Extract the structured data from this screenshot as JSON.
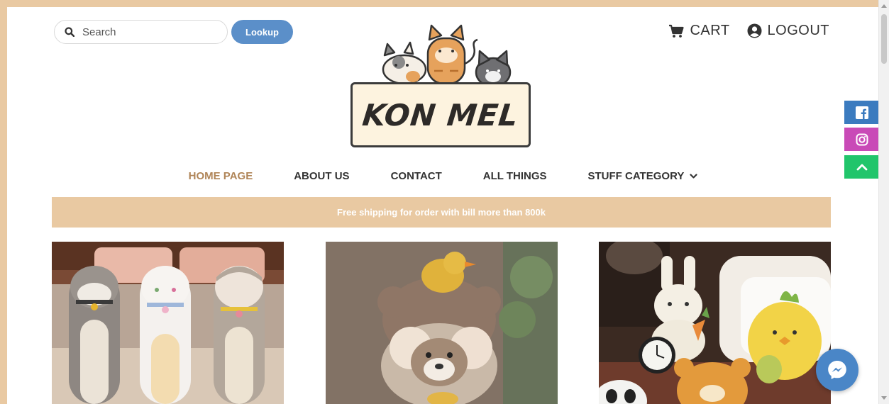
{
  "search": {
    "placeholder": "Search",
    "button_label": "Lookup"
  },
  "top_links": {
    "cart_label": "CART",
    "logout_label": "LOGOUT"
  },
  "brand": {
    "name": "KON MEL"
  },
  "nav": {
    "items": [
      {
        "label": "HOME PAGE",
        "active": true
      },
      {
        "label": "ABOUT US",
        "active": false
      },
      {
        "label": "CONTACT",
        "active": false
      },
      {
        "label": "ALL THINGS",
        "active": false
      },
      {
        "label": "STUFF CATEGORY",
        "active": false,
        "has_dropdown": true
      }
    ]
  },
  "banner": {
    "text": "Free shipping for order with bill more than 800k"
  },
  "products": [
    {
      "image": "long-cat-plush-pillows"
    },
    {
      "image": "teddy-bears-with-duck"
    },
    {
      "image": "bunny-chick-panda-plushies"
    }
  ],
  "social": [
    {
      "icon": "facebook-icon",
      "color": "#3b7bbf"
    },
    {
      "icon": "instagram-icon",
      "color": "#c94ab7"
    },
    {
      "icon": "chevron-up-icon",
      "color": "#21c56b"
    }
  ],
  "colors": {
    "accent": "#e9c9a2",
    "active_nav": "#b08558",
    "button": "#5b8fc9",
    "messenger": "#4a86c7"
  }
}
